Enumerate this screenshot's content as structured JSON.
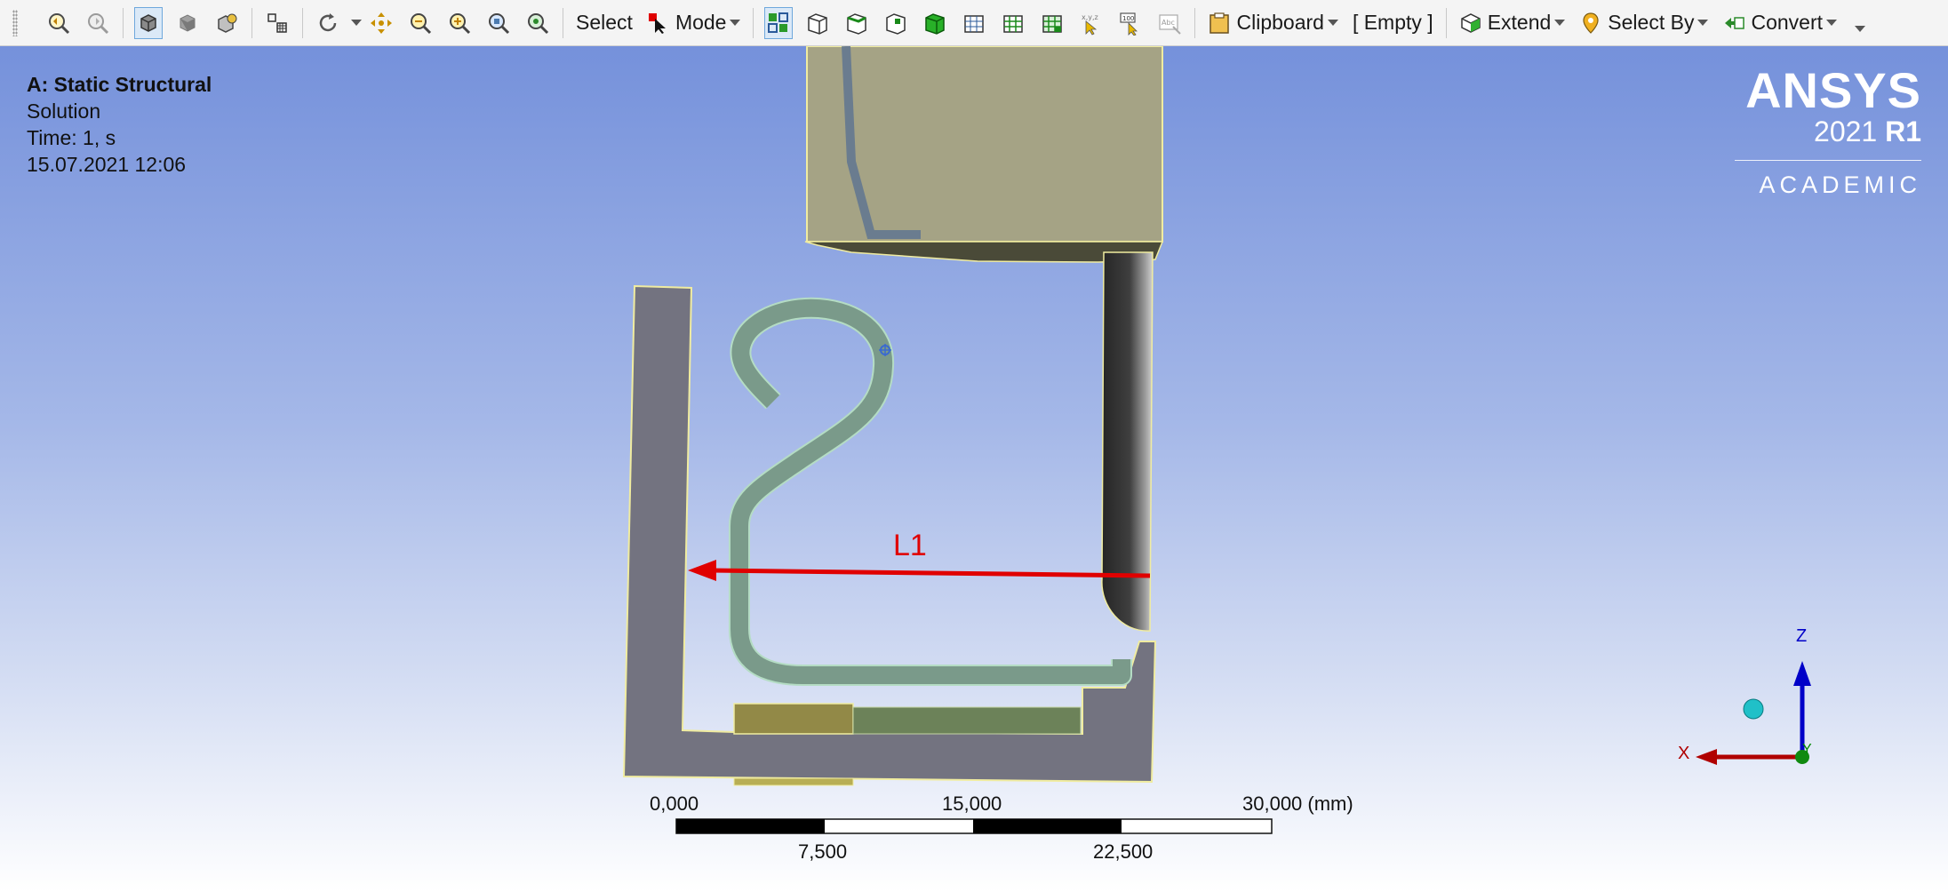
{
  "toolbar": {
    "select_label": "Select",
    "mode_label": "Mode",
    "clipboard_label": "Clipboard",
    "empty_label": "[ Empty ]",
    "extend_label": "Extend",
    "select_by_label": "Select By",
    "convert_label": "Convert",
    "icons": [
      "zoom-previous-icon",
      "zoom-next-icon",
      "box-select-icon",
      "box-solid-icon",
      "box-wire-icon",
      "select-mode-icon",
      "rotate-icon",
      "pan-icon",
      "zoom-icon",
      "zoom-in-icon",
      "zoom-fit-icon",
      "zoom-box-icon",
      "mode-cursor-icon",
      "filter-icon",
      "face-icon",
      "edge-icon",
      "vertex-icon",
      "body-icon",
      "mesh-node-icon",
      "mesh-element-icon",
      "mesh-face-icon",
      "xyz-icon",
      "probe-icon",
      "label-icon"
    ]
  },
  "info": {
    "title": "A: Static Structural",
    "type": "Solution",
    "time": "Time: 1, s",
    "date": "15.07.2021 12:06"
  },
  "brand": {
    "name": "ANSYS",
    "version_year": "2021",
    "version_release": "R1",
    "edition": "ACADEMIC",
    "color": "#ffffff"
  },
  "model": {
    "dimension_label": "L1",
    "dimension_color": "#e00000",
    "colors": {
      "frame": "#737380",
      "spring": "#7a9a8a",
      "upper_block": "#a5a385",
      "roller": "#4a4a4a",
      "base_left": "#928947",
      "base_right": "#6c8259"
    }
  },
  "scale": {
    "labels_top": [
      "0,000",
      "15,000",
      "30,000 (mm)"
    ],
    "labels_bottom": [
      "7,500",
      "22,500"
    ]
  },
  "triad": {
    "z_label": "Z",
    "x_label": "X",
    "y_label": "Y",
    "z_color": "#0000c8",
    "x_color": "#b00000",
    "y_color": "#008800",
    "iso_color": "#20c0c8"
  }
}
